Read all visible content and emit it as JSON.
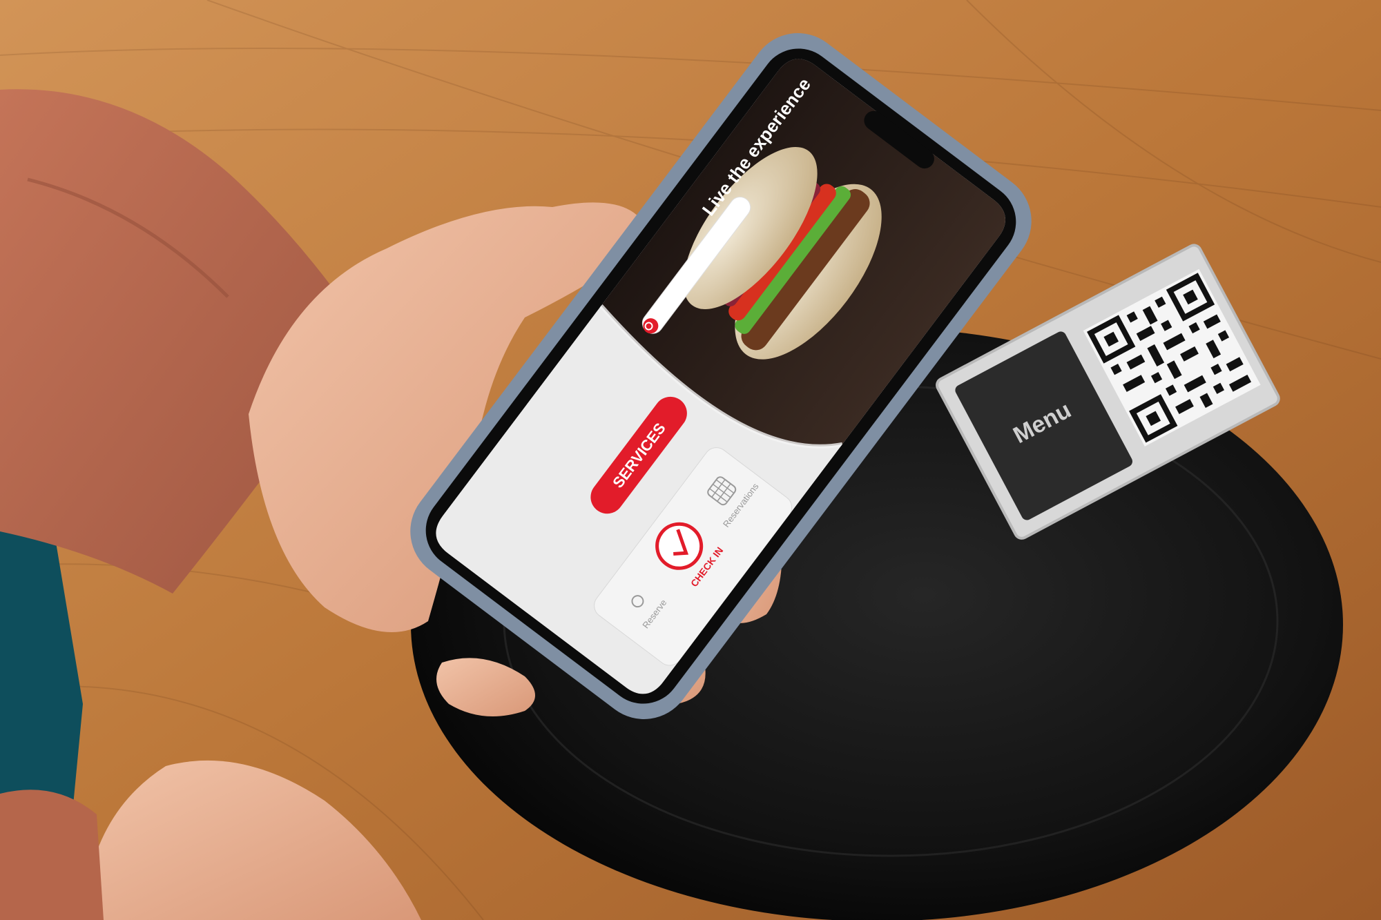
{
  "app": {
    "headline": "Live the experience",
    "search": {
      "placeholder": ""
    },
    "buttons": {
      "services": "SERVICES",
      "check_in": "CHECK IN"
    },
    "nav": {
      "reserve": "Reserve",
      "reservations": "Reservations"
    }
  },
  "table_stand": {
    "label": "Menu"
  },
  "colors": {
    "accent_red": "#e21c2a",
    "phone_case": "#7f8fa3",
    "table_wood": "#b87438",
    "plate": "#141414",
    "sleeve": "#b5664b"
  },
  "icons": [
    "search-icon",
    "checkmark-circle-icon",
    "calendar-grid-icon",
    "qr-code"
  ]
}
